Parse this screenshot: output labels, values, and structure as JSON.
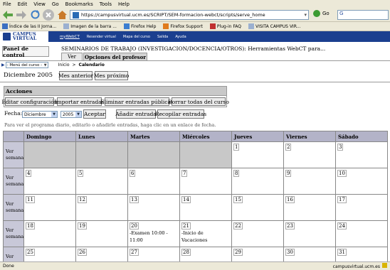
{
  "browser": {
    "menu": [
      "File",
      "Edit",
      "View",
      "Go",
      "Bookmarks",
      "Tools",
      "Help"
    ],
    "url": "https://campusvirtual.ucm.es/SCRIPT/SEM-formacion-webct/scripts/serve_home",
    "go_label": "Go",
    "search_value": "G",
    "bookmarks": [
      "Índice de las II Jorna...",
      "Imagen de la barra ...",
      "Firefox Help",
      "Firefox Support",
      "Plug-in FAQ",
      "VISITA CAMPUS VIR..."
    ],
    "status_left": "Done",
    "status_right": "campusvirtual.ucm.es"
  },
  "webct": {
    "logo_line1": "CAMPUS",
    "logo_line2": "VIRTUAL",
    "header_links": [
      "myWebCT",
      "Resender virtual",
      "Mapa del curso",
      "Salida",
      "Ayuda"
    ],
    "panel_label": "Panel de control",
    "course_title": "SEMINARIOS DE TRABAJO (INVESTIGACION/DOCENCIA/OTROS): Herramientas WebCT para...",
    "tab_ver": "Ver",
    "tab_opciones": "Opciones del profesor",
    "menu_select": "- Menú del curso -",
    "breadcrumb": [
      "Inicio",
      ">",
      "Calendario"
    ]
  },
  "calendar": {
    "month_title": "Diciembre 2005",
    "prev_month": "Mes anterior",
    "next_month": "Mes próximo",
    "acciones_title": "Acciones",
    "actions": [
      "Editar configuración",
      "Importar entradas",
      "Eliminar entradas públicas",
      "Borrar todas del curso"
    ],
    "fecha_label": "Fecha:",
    "month_select": "Diciembre",
    "year_select": "2005",
    "accept": "Aceptar",
    "add_entry": "Añadir entrada",
    "compile": "Recopilar entradas",
    "hint": "Para ver el programa diario, editarlo o añadirle entradas, haga clic en un enlace de fecha.",
    "days": [
      "Domingo",
      "Lunes",
      "Martes",
      "Miércoles",
      "Jueves",
      "Viernes",
      "Sábado"
    ],
    "week_label_1": "Ver",
    "week_label_2": "semana",
    "weeks": [
      [
        "",
        "",
        "",
        "",
        "1",
        "2",
        "3"
      ],
      [
        "4",
        "5",
        "6",
        "7",
        "8",
        "9",
        "10"
      ],
      [
        "11",
        "12",
        "13",
        "14",
        "15",
        "16",
        "17"
      ],
      [
        "18",
        "19",
        "20",
        "21",
        "22",
        "23",
        "24"
      ],
      [
        "25",
        "26",
        "27",
        "28",
        "29",
        "30",
        "31"
      ]
    ],
    "events": {
      "20": [
        "-Examen 10:00 -",
        "11:00"
      ],
      "21": [
        "-Inicio de",
        "Vacaciones"
      ]
    }
  }
}
